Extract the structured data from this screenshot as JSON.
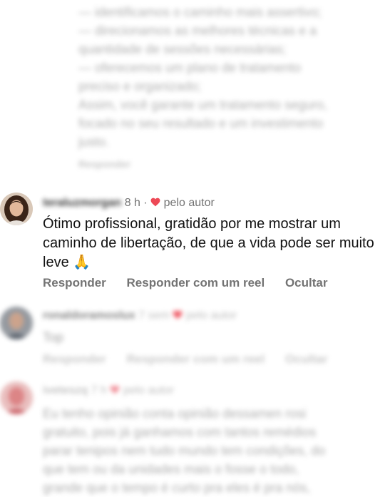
{
  "top_comment": {
    "lines": [
      "— identificamos o caminho mais assertivo;",
      "— direcionamos as melhores técnicas e a",
      "quantidade de sessões necessárias;",
      "— oferecemos um plano de tratamento",
      "preciso e organizado;",
      "Assim, você garante um tratamento seguro,",
      "focado no seu resultado e um investimento",
      "justo."
    ],
    "reply_label": "Responder"
  },
  "main_comment": {
    "username": "teraluzmorgan",
    "time": "8 h",
    "separator": "·",
    "liked_by_author": "pelo autor",
    "text": "Ótimo profissional, gratidão por me mostrar um caminho de libertação, de que a vida pode ser muito leve 🙏",
    "actions": {
      "reply": "Responder",
      "reply_reel": "Responder com um reel",
      "hide": "Ocultar"
    }
  },
  "comment_2": {
    "username": "ronaldoramoslux",
    "time": "7 sem",
    "liked_by_author": "pelo autor",
    "text": "Top",
    "actions": {
      "reply": "Responder",
      "reply_reel": "Responder com um reel",
      "hide": "Ocultar"
    }
  },
  "comment_3": {
    "username": "iveteszq",
    "time": "7 h",
    "liked_by_author": "pelo autor",
    "lines": [
      "Eu tenho opinião conta opinião dessamen rosi",
      "gratuito, pois já ganhamos com tantos remédios",
      "parar tenipos nem tudo mundo tem condições, do",
      "que tem ou da unidades mais o fosse o todo,",
      "grande que o tempo é curto pra eles é pra nós,"
    ]
  },
  "colors": {
    "heart": "#ed4956",
    "muted": "#737373",
    "text": "#111111"
  }
}
